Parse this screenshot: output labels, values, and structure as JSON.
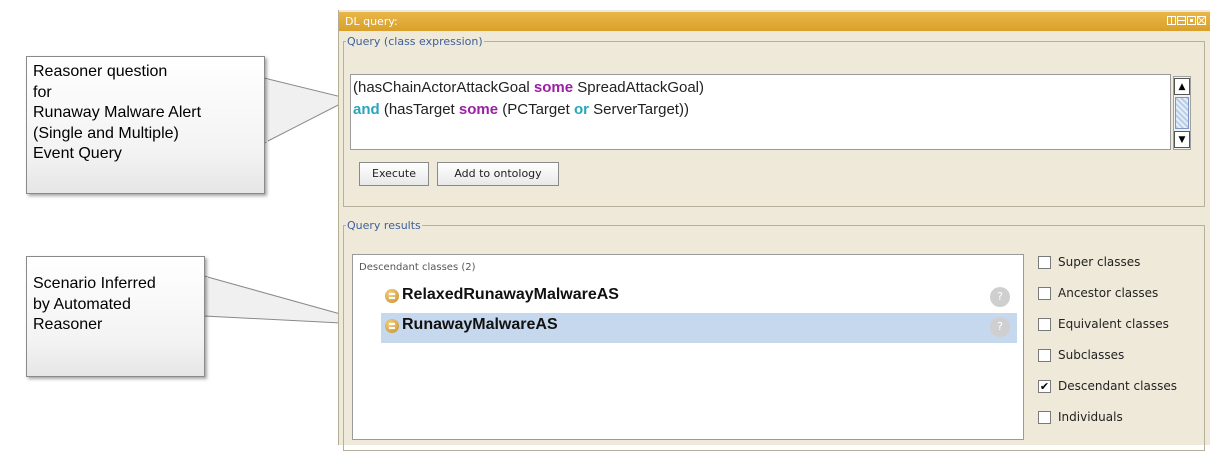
{
  "callouts": {
    "reasoner": [
      "Reasoner question",
      "for",
      "Runaway Malware Alert",
      "(Single and Multiple)",
      "Event Query"
    ],
    "inferred": [
      "Scenario Inferred",
      "by Automated",
      "Reasoner"
    ]
  },
  "window": {
    "title": "DL query:",
    "controls": [
      "view-icon",
      "split-icon",
      "maximize-icon",
      "close-icon"
    ]
  },
  "query": {
    "legend": "Query (class expression)",
    "line1": {
      "pre": "(hasChainActorAttackGoal ",
      "kw": "some",
      "post": " SpreadAttackGoal)"
    },
    "line2": {
      "kw1": "and",
      "mid1": " (hasTarget ",
      "kw2": "some",
      "mid2": " (PCTarget ",
      "kw3": "or",
      "post": " ServerTarget))"
    },
    "execute_label": "Execute",
    "add_label": "Add to ontology"
  },
  "results": {
    "legend": "Query results",
    "header": "Descendant classes (2)",
    "items": [
      {
        "name": "RelaxedRunawayMalwareAS",
        "selected": false
      },
      {
        "name": "RunawayMalwareAS",
        "selected": true
      }
    ],
    "help_symbol": "?"
  },
  "options": [
    {
      "label": "Super classes",
      "checked": false
    },
    {
      "label": "Ancestor classes",
      "checked": false
    },
    {
      "label": "Equivalent classes",
      "checked": false
    },
    {
      "label": "Subclasses",
      "checked": false
    },
    {
      "label": "Descendant classes",
      "checked": true
    },
    {
      "label": "Individuals",
      "checked": false
    }
  ],
  "colors": {
    "title_bar": "#d9a02a",
    "keyword_some": "#9b1fa3",
    "keyword_and_or": "#27a5bf",
    "selection": "#c6d8ee",
    "legend_text": "#3d5f9b"
  }
}
